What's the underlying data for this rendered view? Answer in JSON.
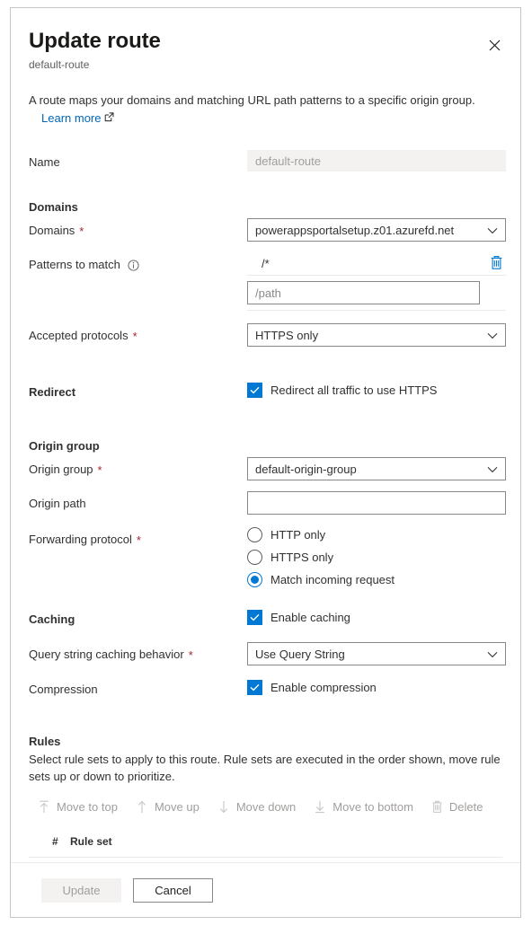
{
  "header": {
    "title": "Update route",
    "subtitle": "default-route",
    "close_icon": "close-icon"
  },
  "description": {
    "text": "A route maps your domains and matching URL path patterns to a specific origin group.",
    "learn_more": "Learn more",
    "external_icon": "external-link-icon"
  },
  "fields": {
    "name": {
      "label": "Name",
      "value": "default-route"
    },
    "domains_section": "Domains",
    "domains": {
      "label": "Domains",
      "required": "*",
      "value": "powerappsportalsetup.z01.azurefd.net"
    },
    "patterns": {
      "label": "Patterns to match",
      "info_icon": "info-icon",
      "value": "/*",
      "delete_icon": "delete-icon",
      "input_placeholder": "/path",
      "input_value": ""
    },
    "accepted_protocols": {
      "label": "Accepted protocols",
      "required": "*",
      "value": "HTTPS only"
    },
    "redirect": {
      "label": "Redirect",
      "checkbox_label": "Redirect all traffic to use HTTPS",
      "checked": true
    },
    "origin_group_section": "Origin group",
    "origin_group": {
      "label": "Origin group",
      "required": "*",
      "value": "default-origin-group"
    },
    "origin_path": {
      "label": "Origin path",
      "value": "",
      "placeholder": ""
    },
    "forwarding_protocol": {
      "label": "Forwarding protocol",
      "required": "*",
      "options": [
        {
          "label": "HTTP only",
          "selected": false
        },
        {
          "label": "HTTPS only",
          "selected": false
        },
        {
          "label": "Match incoming request",
          "selected": true
        }
      ]
    },
    "caching": {
      "label": "Caching",
      "checkbox_label": "Enable caching",
      "checked": true
    },
    "query_string": {
      "label": "Query string caching behavior",
      "required": "*",
      "value": "Use Query String"
    },
    "compression": {
      "label": "Compression",
      "checkbox_label": "Enable compression",
      "checked": true
    }
  },
  "rules": {
    "heading": "Rules",
    "description": "Select rule sets to apply to this route. Rule sets are executed in the order shown, move rule sets up or down to prioritize.",
    "commands": [
      {
        "label": "Move to top",
        "icon": "move-to-top-icon"
      },
      {
        "label": "Move up",
        "icon": "arrow-up-icon"
      },
      {
        "label": "Move down",
        "icon": "arrow-down-icon"
      },
      {
        "label": "Move to bottom",
        "icon": "move-to-bottom-icon"
      },
      {
        "label": "Delete",
        "icon": "trash-icon"
      }
    ],
    "columns": [
      "#",
      "Rule set"
    ],
    "rows": []
  },
  "footer": {
    "update_label": "Update",
    "cancel_label": "Cancel"
  },
  "colors": {
    "accent": "#0078d4",
    "link": "#0067b8",
    "required": "#a4262c",
    "border": "#8a8886",
    "panel_border": "#c8c6c4"
  }
}
